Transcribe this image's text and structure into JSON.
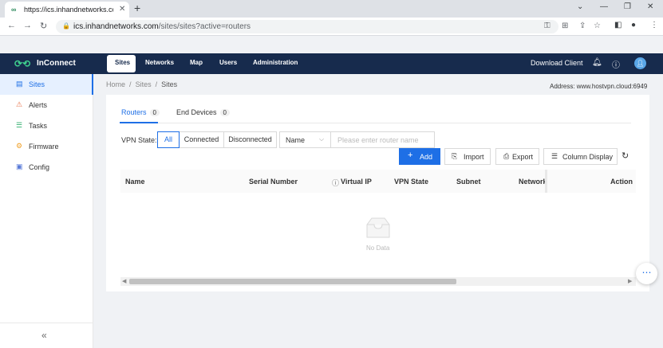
{
  "browser": {
    "tab_title": "https://ics.inhandnetworks.com",
    "tab_favicon": "inhand-logo-icon",
    "url_host": "ics.inhandnetworks.com",
    "url_path": "/sites/sites?active=routers"
  },
  "header": {
    "brand": "InConnect",
    "nav": [
      "Sites",
      "Networks",
      "Map",
      "Users",
      "Administration"
    ],
    "active_nav": "Sites",
    "download_client": "Download Client"
  },
  "sidebar": {
    "items": [
      {
        "label": "Sites",
        "icon": "sites-icon",
        "active": true
      },
      {
        "label": "Alerts",
        "icon": "alerts-icon"
      },
      {
        "label": "Tasks",
        "icon": "tasks-icon"
      },
      {
        "label": "Firmware",
        "icon": "firmware-icon"
      },
      {
        "label": "Config",
        "icon": "config-icon"
      }
    ],
    "collapse": "«"
  },
  "breadcrumb": [
    "Home",
    "Sites",
    "Sites"
  ],
  "address": "Address: www.hostvpn.cloud:6949",
  "tabs": [
    {
      "label": "Routers",
      "count": "0",
      "active": true
    },
    {
      "label": "End Devices",
      "count": "0"
    }
  ],
  "filters": {
    "vpn_state_label": "VPN State:",
    "segments": [
      "All",
      "Connected",
      "Disconnected"
    ],
    "active_segment": "All",
    "search_field": "Name",
    "search_placeholder": "Please enter router name"
  },
  "actions": {
    "add": "Add",
    "import": "Import",
    "export": "Export",
    "column_display": "Column Display"
  },
  "table": {
    "columns": [
      "Name",
      "Serial Number",
      "Virtual IP",
      "VPN State",
      "Subnet",
      "Network",
      "Action"
    ],
    "empty_text": "No Data"
  },
  "colors": {
    "header_bg": "#172b4d",
    "accent": "#1e6fe6"
  }
}
